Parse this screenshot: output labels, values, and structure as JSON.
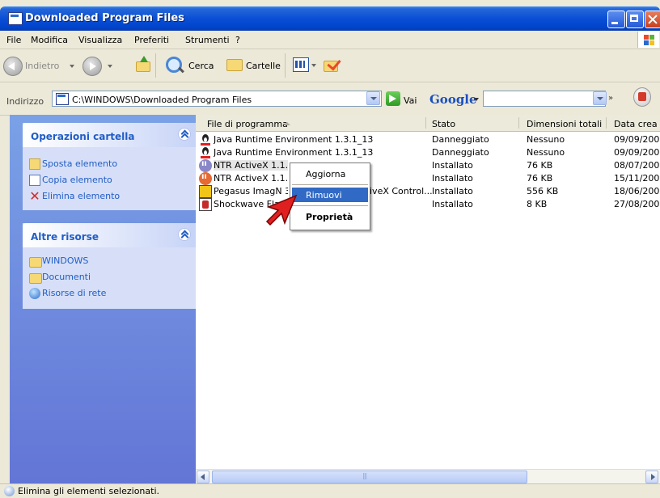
{
  "window": {
    "title": "Downloaded Program Files"
  },
  "menu": [
    "File",
    "Modifica",
    "Visualizza",
    "Preferiti",
    "Strumenti",
    "?"
  ],
  "toolbar": {
    "back": "Indietro",
    "search": "Cerca",
    "folders": "Cartelle"
  },
  "address": {
    "label": "Indirizzo",
    "path": "C:\\WINDOWS\\Downloaded Program Files",
    "go": "Vai"
  },
  "google": {
    "brand": "Google",
    "query": ""
  },
  "tasks": {
    "title": "Operazioni cartella",
    "items": [
      "Sposta elemento",
      "Copia elemento",
      "Elimina elemento"
    ]
  },
  "other": {
    "title": "Altre risorse",
    "items": [
      "WINDOWS",
      "Documenti",
      "Risorse di rete"
    ]
  },
  "columns": [
    "File di programma",
    "Stato",
    "Dimensioni totali",
    "Data crea"
  ],
  "rows": [
    {
      "name": "Java Runtime Environment 1.3.1_13",
      "stato": "Danneggiato",
      "dim": "Nessuno",
      "data": "09/09/200"
    },
    {
      "name": "Java Runtime Environment 1.3.1_13",
      "stato": "Danneggiato",
      "dim": "Nessuno",
      "data": "09/09/200"
    },
    {
      "name": "NTR ActiveX 1.1.4",
      "stato": "Installato",
      "dim": "76 KB",
      "data": "08/07/200"
    },
    {
      "name": "NTR ActiveX 1.1.6",
      "stato": "Installato",
      "dim": "76 KB",
      "data": "15/11/200"
    },
    {
      "name": "Pegasus ImagN 32",
      "tail": "iveX Control...",
      "stato": "Installato",
      "dim": "556 KB",
      "data": "18/06/200"
    },
    {
      "name": "Shockwave Flash",
      "stato": "Installato",
      "dim": "8 KB",
      "data": "27/08/200"
    }
  ],
  "context_menu": {
    "items": [
      "Aggiorna",
      "Rimuovi",
      "Proprietà"
    ],
    "highlighted": "Rimuovi"
  },
  "status": {
    "text": "Elimina gli elementi selezionati."
  },
  "colors": {
    "title_bar": "#0a4fd6",
    "task_link": "#215dc6",
    "selection": "#316ac5"
  }
}
